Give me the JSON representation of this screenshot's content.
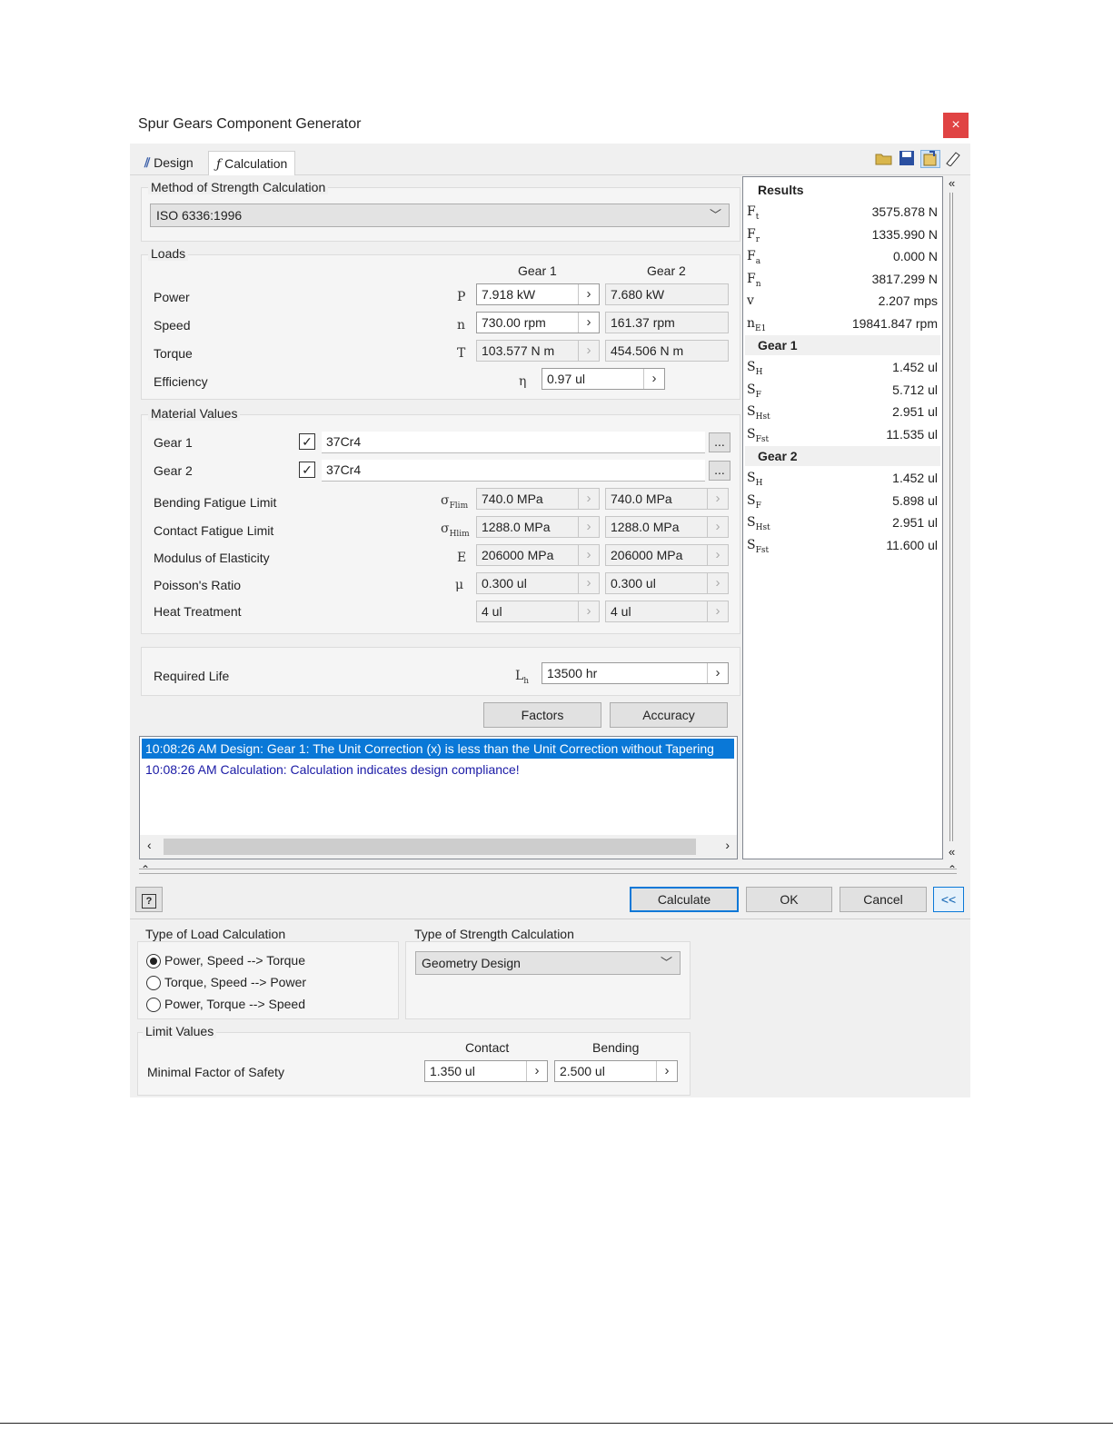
{
  "window": {
    "title": "Spur Gears Component Generator",
    "close": "×"
  },
  "tabs": [
    {
      "label": "Design"
    },
    {
      "label": "Calculation"
    }
  ],
  "method": {
    "label": "Method of Strength Calculation",
    "value": "ISO 6336:1996"
  },
  "loads": {
    "label": "Loads",
    "col_gear1": "Gear 1",
    "col_gear2": "Gear 2",
    "power": {
      "label": "Power",
      "sym": "P",
      "g1": "7.918 kW",
      "g2": "7.680 kW"
    },
    "speed": {
      "label": "Speed",
      "sym": "n",
      "g1": "730.00 rpm",
      "g2": "161.37 rpm"
    },
    "torque": {
      "label": "Torque",
      "sym": "T",
      "g1": "103.577 N m",
      "g2": "454.506 N m"
    },
    "efficiency": {
      "label": "Efficiency",
      "sym": "η",
      "value": "0.97 ul"
    }
  },
  "material": {
    "label": "Material Values",
    "gear1": {
      "label": "Gear 1",
      "value": "37Cr4",
      "browse": "..."
    },
    "gear2": {
      "label": "Gear 2",
      "value": "37Cr4",
      "browse": "..."
    },
    "bending": {
      "label": "Bending Fatigue Limit",
      "sym": "σ",
      "sub": "Flim",
      "g1": "740.0 MPa",
      "g2": "740.0 MPa"
    },
    "contact": {
      "label": "Contact Fatigue Limit",
      "sym": "σ",
      "sub": "Hlim",
      "g1": "1288.0 MPa",
      "g2": "1288.0 MPa"
    },
    "modulus": {
      "label": "Modulus of Elasticity",
      "sym": "E",
      "g1": "206000 MPa",
      "g2": "206000 MPa"
    },
    "poisson": {
      "label": "Poisson's Ratio",
      "sym": "μ",
      "g1": "0.300 ul",
      "g2": "0.300 ul"
    },
    "heat": {
      "label": "Heat Treatment",
      "g1": "4 ul",
      "g2": "4 ul"
    }
  },
  "life": {
    "label": "Required Life",
    "sym": "L",
    "sub": "h",
    "value": "13500 hr"
  },
  "buttons": {
    "factors": "Factors",
    "accuracy": "Accuracy",
    "calculate": "Calculate",
    "ok": "OK",
    "cancel": "Cancel",
    "collapse": "<<"
  },
  "log": [
    "10:08:26 AM Design: Gear 1: The Unit Correction (x) is less than the Unit Correction without Tapering",
    "10:08:26 AM Calculation: Calculation indicates design compliance!"
  ],
  "results": {
    "title": "Results",
    "general": [
      {
        "sym": "F",
        "sub": "t",
        "value": "3575.878 N"
      },
      {
        "sym": "F",
        "sub": "r",
        "value": "1335.990 N"
      },
      {
        "sym": "F",
        "sub": "a",
        "value": "0.000 N"
      },
      {
        "sym": "F",
        "sub": "n",
        "value": "3817.299 N"
      },
      {
        "sym": "v",
        "sub": "",
        "value": "2.207 mps"
      },
      {
        "sym": "n",
        "sub": "E1",
        "value": "19841.847 rpm"
      }
    ],
    "gear1_title": "Gear 1",
    "gear1": [
      {
        "sym": "S",
        "sub": "H",
        "value": "1.452 ul"
      },
      {
        "sym": "S",
        "sub": "F",
        "value": "5.712 ul"
      },
      {
        "sym": "S",
        "sub": "Hst",
        "value": "2.951 ul"
      },
      {
        "sym": "S",
        "sub": "Fst",
        "value": "11.535 ul"
      }
    ],
    "gear2_title": "Gear 2",
    "gear2": [
      {
        "sym": "S",
        "sub": "H",
        "value": "1.452 ul"
      },
      {
        "sym": "S",
        "sub": "F",
        "value": "5.898 ul"
      },
      {
        "sym": "S",
        "sub": "Hst",
        "value": "2.951 ul"
      },
      {
        "sym": "S",
        "sub": "Fst",
        "value": "11.600 ul"
      }
    ]
  },
  "load_calc": {
    "label": "Type of Load Calculation",
    "options": [
      "Power, Speed --> Torque",
      "Torque, Speed --> Power",
      "Power, Torque --> Speed"
    ],
    "selected_index": 0
  },
  "strength_calc": {
    "label": "Type of Strength Calculation",
    "value": "Geometry Design"
  },
  "limits": {
    "label": "Limit Values",
    "col_contact": "Contact",
    "col_bending": "Bending",
    "row_label": "Minimal Factor of Safety",
    "contact": "1.350 ul",
    "bending": "2.500 ul"
  },
  "icons": {
    "help": "help-icon",
    "open": "folder-icon",
    "save": "save-icon",
    "export": "export-icon",
    "options": "options-icon"
  },
  "colors": {
    "selection": "#0a78d7",
    "close": "#e04343",
    "info_text": "#1a1aa6"
  }
}
